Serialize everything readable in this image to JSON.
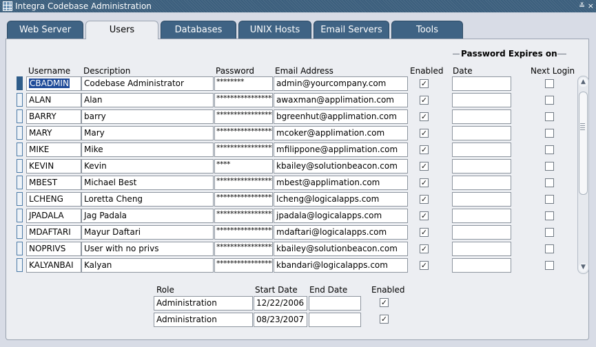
{
  "window": {
    "title": "Integra Codebase Administration",
    "controls": "≚ ×"
  },
  "tabs": [
    {
      "label": "Web Server",
      "active": false
    },
    {
      "label": "Users",
      "active": true
    },
    {
      "label": "Databases",
      "active": false
    },
    {
      "label": "UNIX Hosts",
      "active": false
    },
    {
      "label": "Email Servers",
      "active": false
    },
    {
      "label": "Tools",
      "active": false
    }
  ],
  "users": {
    "group_title": "Password Expires on",
    "headers": {
      "username": "Username",
      "description": "Description",
      "password": "Password",
      "email": "Email Address",
      "enabled": "Enabled",
      "date": "Date",
      "next_login": "Next Login"
    },
    "rows": [
      {
        "username": "CBADMIN",
        "description": "Codebase Administrator",
        "password": "********",
        "email": "admin@yourcompany.com",
        "enabled": true,
        "date": "",
        "next_login": false
      },
      {
        "username": "ALAN",
        "description": "Alan",
        "password": "*****************",
        "email": "awaxman@applimation.com",
        "enabled": true,
        "date": "",
        "next_login": false
      },
      {
        "username": "BARRY",
        "description": "barry",
        "password": "*****************",
        "email": "bgreenhut@applimation.com",
        "enabled": true,
        "date": "",
        "next_login": false
      },
      {
        "username": "MARY",
        "description": "Mary",
        "password": "*****************",
        "email": "mcoker@applimation.com",
        "enabled": true,
        "date": "",
        "next_login": false
      },
      {
        "username": "MIKE",
        "description": "Mike",
        "password": "*****************",
        "email": "mfilippone@applimation.com",
        "enabled": true,
        "date": "",
        "next_login": false
      },
      {
        "username": "KEVIN",
        "description": "Kevin",
        "password": "****",
        "email": "kbailey@solutionbeacon.com",
        "enabled": true,
        "date": "",
        "next_login": false
      },
      {
        "username": "MBEST",
        "description": "Michael Best",
        "password": "*****************",
        "email": "mbest@applimation.com",
        "enabled": true,
        "date": "",
        "next_login": false
      },
      {
        "username": "LCHENG",
        "description": "Loretta Cheng",
        "password": "*****************",
        "email": "lcheng@logicalapps.com",
        "enabled": true,
        "date": "",
        "next_login": false
      },
      {
        "username": "JPADALA",
        "description": "Jag Padala",
        "password": "*****************",
        "email": "jpadala@logicalapps.com",
        "enabled": true,
        "date": "",
        "next_login": false
      },
      {
        "username": "MDAFTARI",
        "description": "Mayur Daftari",
        "password": "*****************",
        "email": "mdaftari@logicalapps.com",
        "enabled": true,
        "date": "",
        "next_login": false
      },
      {
        "username": "NOPRIVS",
        "description": "User with no privs",
        "password": "*****************",
        "email": "kbailey@solutionbeacon.com",
        "enabled": true,
        "date": "",
        "next_login": false
      },
      {
        "username": "KALYANBAI",
        "description": "Kalyan",
        "password": "*****************",
        "email": "kbandari@logicalapps.com",
        "enabled": true,
        "date": "",
        "next_login": false
      }
    ]
  },
  "roles": {
    "headers": {
      "role": "Role",
      "start_date": "Start Date",
      "end_date": "End Date",
      "enabled": "Enabled"
    },
    "rows": [
      {
        "role": "Administration",
        "start_date": "12/22/2006",
        "end_date": "",
        "enabled": true
      },
      {
        "role": "Administration",
        "start_date": "08/23/2007",
        "end_date": "",
        "enabled": true
      }
    ]
  },
  "icons": {
    "check": "✓",
    "scroll_up": "▲",
    "scroll_down": "▼"
  }
}
